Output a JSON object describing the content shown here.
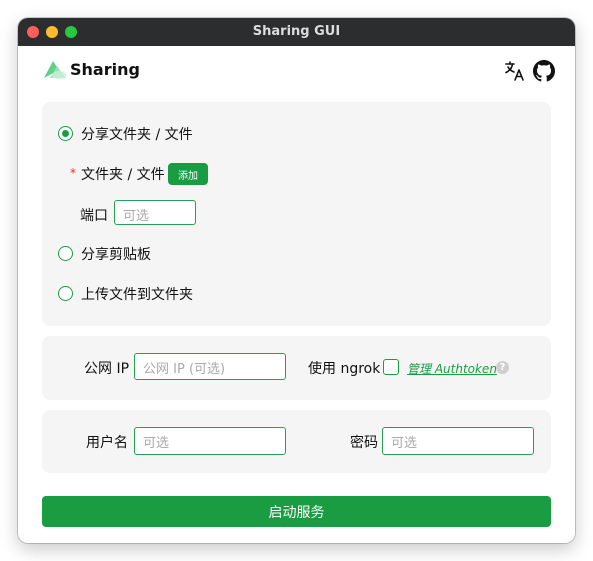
{
  "window": {
    "title": "Sharing GUI"
  },
  "header": {
    "brand": "Sharing",
    "translate_icon": "translate-icon",
    "github_icon": "github-icon"
  },
  "share_mode": {
    "options": [
      {
        "label": "分享文件夹 / 文件",
        "selected": true
      },
      {
        "label": "分享剪贴板",
        "selected": false
      },
      {
        "label": "上传文件到文件夹",
        "selected": false
      }
    ],
    "files_label": "文件夹 / 文件",
    "required_mark": "*",
    "add_button": "添加",
    "port_label": "端口",
    "port_placeholder": "可选"
  },
  "network": {
    "public_ip_label": "公网 IP",
    "public_ip_placeholder": "公网 IP (可选)",
    "ngrok_label": "使用 ngrok",
    "ngrok_checked": false,
    "authtoken_link": "管理 Authtoken",
    "help_glyph": "?"
  },
  "auth": {
    "username_label": "用户名",
    "username_placeholder": "可选",
    "password_label": "密码",
    "password_placeholder": "可选"
  },
  "start_button": "启动服务",
  "colors": {
    "accent": "#1a9c43",
    "panel": "#f5f5f5",
    "titlebar": "#2c2d2f"
  }
}
